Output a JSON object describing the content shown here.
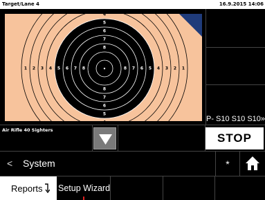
{
  "header": {
    "title": "Target/Lane 4",
    "datetime": "16.9.2015 14:06"
  },
  "target": {
    "ring_numbers": [
      "1",
      "2",
      "3",
      "4",
      "5",
      "6",
      "7",
      "8"
    ],
    "colors": {
      "paper": "#f7c39c",
      "black": "#000000",
      "corner": "#1f3b7a"
    }
  },
  "series_line": "P- S10 S10 S10»",
  "mode": {
    "label": "Air Rifle 40 Sighters",
    "dropdown_icon": "triangle-down-icon"
  },
  "stop_label": "STOP",
  "nav": {
    "back_icon": "<",
    "title": "System",
    "star": "*",
    "home_icon": "home-icon"
  },
  "tabs": {
    "reports": "Reports",
    "setup_wizard": "Setup Wizard"
  }
}
